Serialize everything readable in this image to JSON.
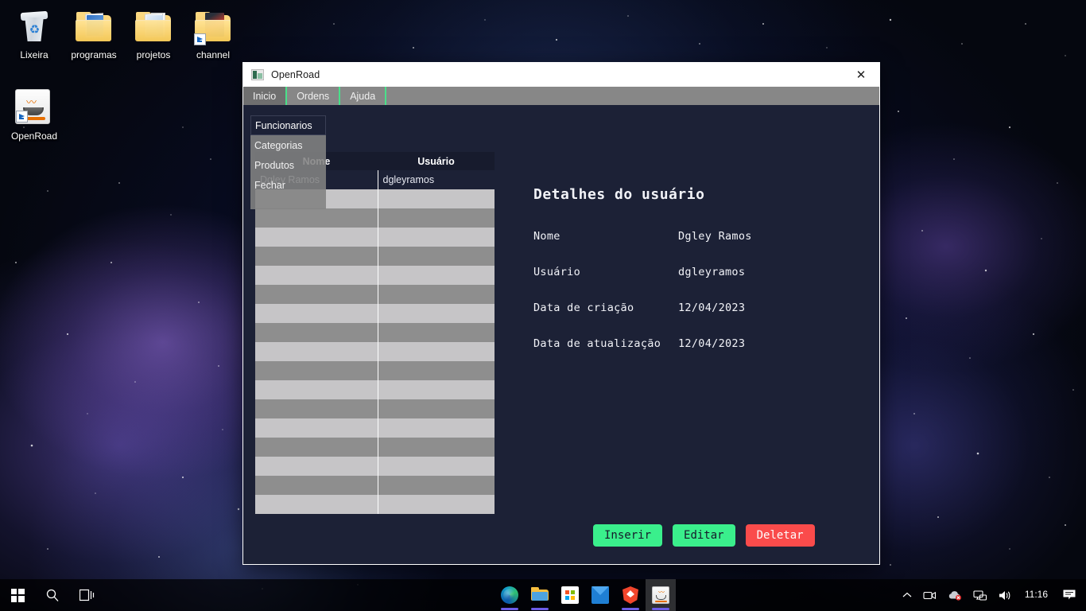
{
  "desktop": {
    "icons": [
      {
        "label": "Lixeira",
        "icon": "recycle-bin-icon",
        "shortcut": false
      },
      {
        "label": "programas",
        "icon": "folder-icon",
        "shortcut": false
      },
      {
        "label": "projetos",
        "icon": "folder-icon",
        "shortcut": false
      },
      {
        "label": "channel",
        "icon": "folder-icon",
        "shortcut": true
      },
      {
        "label": "OpenRoad",
        "icon": "java-app-icon",
        "shortcut": true
      }
    ]
  },
  "window": {
    "title": "OpenRoad",
    "titlebar_icon": "app-window-icon",
    "close_label": "✕",
    "accent_green": "#49e08a",
    "background": "#1c2136",
    "menubar": [
      {
        "label": "Inicio",
        "open": true
      },
      {
        "label": "Ordens",
        "open": false
      },
      {
        "label": "Ajuda",
        "open": false
      }
    ],
    "dropdown": {
      "items": [
        {
          "label": "Funcionarios",
          "selected": true
        },
        {
          "label": "Categorias",
          "selected": false
        },
        {
          "label": "Produtos",
          "selected": false
        },
        {
          "label": "Fechar",
          "selected": false
        }
      ]
    },
    "table": {
      "columns": [
        "Nome",
        "Usuário"
      ],
      "rows": [
        {
          "nome": "Dgley Ramos",
          "usuario": "dgleyramos",
          "selected": true
        },
        {
          "nome": "",
          "usuario": "",
          "selected": false
        },
        {
          "nome": "",
          "usuario": "",
          "selected": false
        },
        {
          "nome": "",
          "usuario": "",
          "selected": false
        },
        {
          "nome": "",
          "usuario": "",
          "selected": false
        },
        {
          "nome": "",
          "usuario": "",
          "selected": false
        },
        {
          "nome": "",
          "usuario": "",
          "selected": false
        },
        {
          "nome": "",
          "usuario": "",
          "selected": false
        },
        {
          "nome": "",
          "usuario": "",
          "selected": false
        },
        {
          "nome": "",
          "usuario": "",
          "selected": false
        },
        {
          "nome": "",
          "usuario": "",
          "selected": false
        },
        {
          "nome": "",
          "usuario": "",
          "selected": false
        },
        {
          "nome": "",
          "usuario": "",
          "selected": false
        },
        {
          "nome": "",
          "usuario": "",
          "selected": false
        },
        {
          "nome": "",
          "usuario": "",
          "selected": false
        },
        {
          "nome": "",
          "usuario": "",
          "selected": false
        },
        {
          "nome": "",
          "usuario": "",
          "selected": false
        },
        {
          "nome": "",
          "usuario": "",
          "selected": false
        }
      ]
    },
    "details": {
      "heading": "Detalhes do usuário",
      "fields": [
        {
          "key": "Nome",
          "value": "Dgley Ramos"
        },
        {
          "key": "Usuário",
          "value": "dgleyramos"
        },
        {
          "key": "Data de criação",
          "value": "12/04/2023"
        },
        {
          "key": "Data de atualização",
          "value": "12/04/2023"
        }
      ]
    },
    "actions": [
      {
        "label": "Inserir",
        "style": "green"
      },
      {
        "label": "Editar",
        "style": "green"
      },
      {
        "label": "Deletar",
        "style": "red"
      }
    ]
  },
  "taskbar": {
    "start_label": "start-menu",
    "search_label": "search",
    "taskview_label": "task-view",
    "apps": [
      {
        "name": "microsoft-edge",
        "running": true,
        "active": false
      },
      {
        "name": "file-explorer",
        "running": true,
        "active": false
      },
      {
        "name": "microsoft-store",
        "running": false,
        "active": false
      },
      {
        "name": "mail",
        "running": false,
        "active": false
      },
      {
        "name": "brave-browser",
        "running": true,
        "active": false
      },
      {
        "name": "openroad-java",
        "running": true,
        "active": true
      }
    ],
    "tray": [
      {
        "name": "show-hidden-icons",
        "glyph": "∧"
      },
      {
        "name": "camera-icon",
        "glyph": "□"
      },
      {
        "name": "onedrive-error-icon",
        "glyph": "☁"
      },
      {
        "name": "network-icon",
        "glyph": "⌨"
      },
      {
        "name": "volume-icon",
        "glyph": "🔊"
      }
    ],
    "clock": "11:16",
    "notifications_label": "notifications"
  }
}
